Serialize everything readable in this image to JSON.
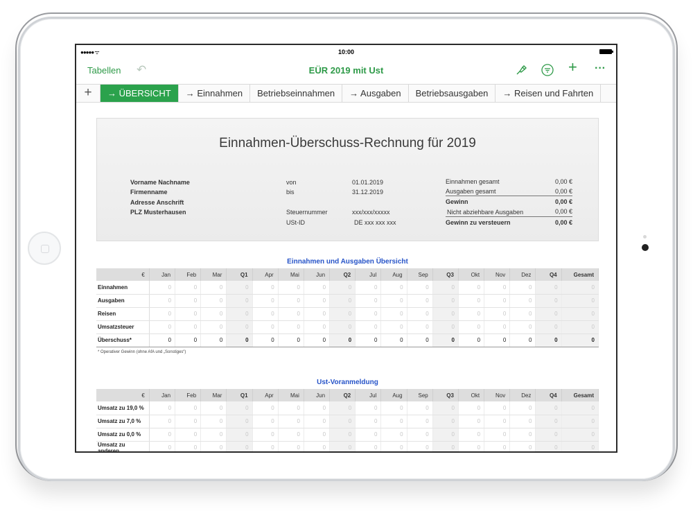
{
  "status": {
    "time": "10:00"
  },
  "toolbar": {
    "back_label": "Tabellen",
    "undo_icon": "undo-icon",
    "title": "EÜR 2019 mit Ust",
    "buttons": [
      "format-brush-icon",
      "filter-icon",
      "add-icon",
      "more-icon"
    ]
  },
  "tabs": [
    {
      "label": "→ ÜBERSICHT",
      "active": true
    },
    {
      "label": "→ Einnahmen"
    },
    {
      "label": "Betriebseinnahmen"
    },
    {
      "label": "→ Ausgaben"
    },
    {
      "label": "Betriebsausgaben"
    },
    {
      "label": "→ Reisen und Fahrten"
    }
  ],
  "header": {
    "title": "Einnahmen-Überschuss-Rechnung für 2019",
    "left": [
      "Vorname Nachname",
      "Firmenname",
      "Adresse Anschrift",
      "PLZ Musterhausen"
    ],
    "mid_labels": [
      "von",
      "bis",
      "Steuernummer",
      "USt-ID"
    ],
    "mid_values": [
      "01.01.2019",
      "31.12.2019",
      "xxx/xxx/xxxxx",
      "DE xxx xxx xxx"
    ],
    "summary": [
      {
        "label": "Einnahmen gesamt",
        "value": "0,00 €"
      },
      {
        "label": "Ausgaben gesamt",
        "value": "0,00 €"
      },
      {
        "label": "Gewinn",
        "value": "0,00 €"
      },
      {
        "label": "Nicht abziehbare Ausgaben",
        "value": "0,00 €"
      },
      {
        "label": "Gewinn zu versteuern",
        "value": "0,00 €"
      }
    ]
  },
  "overview": {
    "title": "Einnahmen und Ausgaben Übersicht",
    "columns": [
      "€",
      "Jan",
      "Feb",
      "Mar",
      "Q1",
      "Apr",
      "Mai",
      "Jun",
      "Q2",
      "Jul",
      "Aug",
      "Sep",
      "Q3",
      "Okt",
      "Nov",
      "Dez",
      "Q4",
      "Gesamt"
    ],
    "rows": [
      "Einnahmen",
      "Ausgaben",
      "Reisen",
      "Umsatzsteuer"
    ],
    "total_row": "Überschuss*",
    "cell_value": "0",
    "footnote": "* Operativer Gewinn (ohne AfA und „Sonstiges“)"
  },
  "ust": {
    "title": "Ust-Voranmeldung",
    "rows": [
      "Umsatz zu  19,0 %",
      "Umsatz zu   7,0 %",
      "Umsatz zu   0,0 %",
      "Umsatz zu anderen"
    ]
  }
}
